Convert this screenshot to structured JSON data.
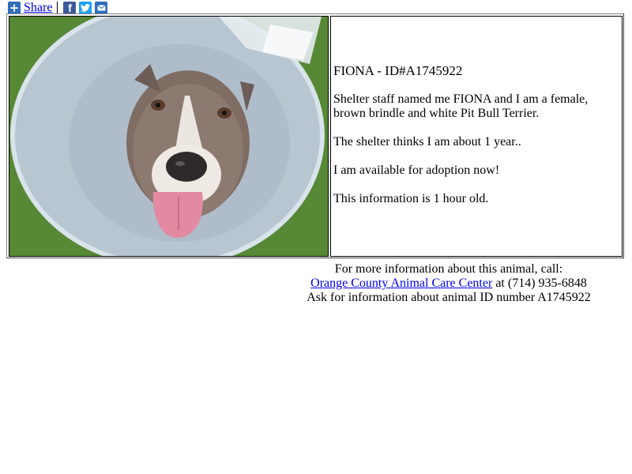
{
  "share_bar": {
    "share_label": "Share",
    "icons": [
      "plus-icon",
      "facebook-icon",
      "twitter-icon",
      "email-icon"
    ],
    "brand_colors": {
      "plus": "#2f6dbe",
      "facebook": "#3b5998",
      "twitter": "#1da1f2",
      "email": "#2a6ebb"
    }
  },
  "animal": {
    "title": "FIONA - ID#A1745922",
    "description": "Shelter staff named me FIONA and I am a female, brown brindle and white Pit Bull Terrier.",
    "age": "The shelter thinks I am about 1 year..",
    "availability": "I am available for adoption now!",
    "freshness": "This information is 1 hour old."
  },
  "footer": {
    "line1": "For more information about this animal, call:",
    "shelter_link": "Orange County Animal Care Center",
    "phone_text": " at (714) 935-6848",
    "line3": "Ask for information about animal ID number A1745922"
  }
}
